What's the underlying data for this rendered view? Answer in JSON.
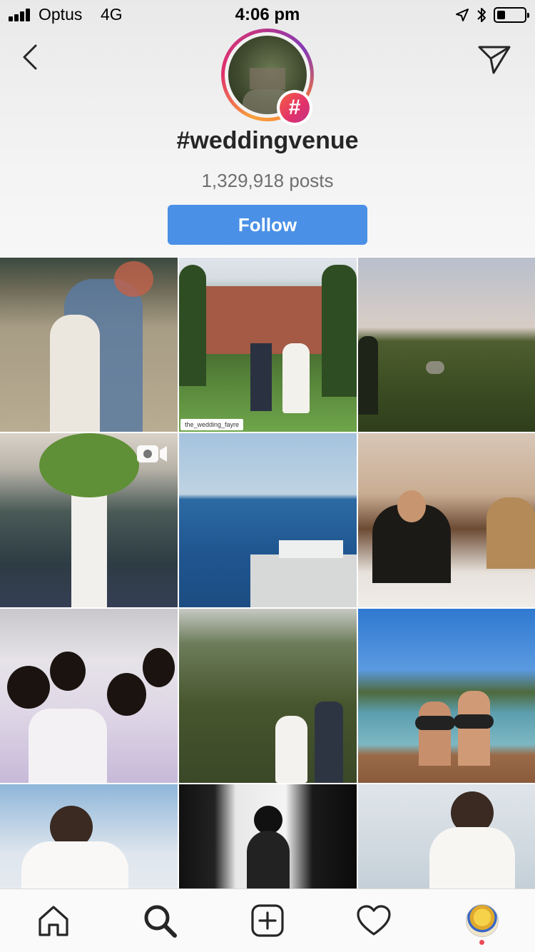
{
  "status_bar": {
    "carrier": "Optus",
    "network": "4G",
    "time": "4:06 pm",
    "icons": [
      "signal-icon",
      "location-arrow-icon",
      "bluetooth-icon",
      "battery-icon"
    ],
    "battery_level_percent": 30
  },
  "header": {
    "back_icon": "chevron-left-icon",
    "share_icon": "paper-plane-icon",
    "hashtag_badge": "#",
    "hashtag": "#weddingvenue",
    "post_count": "1,329,918 posts",
    "follow_label": "Follow"
  },
  "grid": {
    "overlays": {
      "repost_credit": "the_wedding_fayre"
    },
    "items": [
      {
        "type": "photo",
        "subject": "couple embracing in field"
      },
      {
        "type": "photo",
        "subject": "couple at manor house"
      },
      {
        "type": "photo",
        "subject": "coastal hillside"
      },
      {
        "type": "video",
        "subject": "decorated venue hall"
      },
      {
        "type": "photo",
        "subject": "sea and boats"
      },
      {
        "type": "photo",
        "subject": "groom signing"
      },
      {
        "type": "photo",
        "subject": "bridesmaids celebrating"
      },
      {
        "type": "photo",
        "subject": "couple among trees"
      },
      {
        "type": "photo",
        "subject": "lake couple with floats"
      },
      {
        "type": "photo",
        "subject": "bride by window"
      },
      {
        "type": "photo",
        "subject": "bride silhouette"
      },
      {
        "type": "photo",
        "subject": "bride on balcony"
      }
    ]
  },
  "tab_bar": {
    "tabs": [
      "home-icon",
      "search-icon",
      "add-post-icon",
      "activity-heart-icon",
      "profile-avatar"
    ]
  },
  "colors": {
    "follow_button": "#4a90e6",
    "notification_dot": "#ed4956",
    "text_primary": "#262626",
    "text_secondary": "#6f6f6f"
  }
}
